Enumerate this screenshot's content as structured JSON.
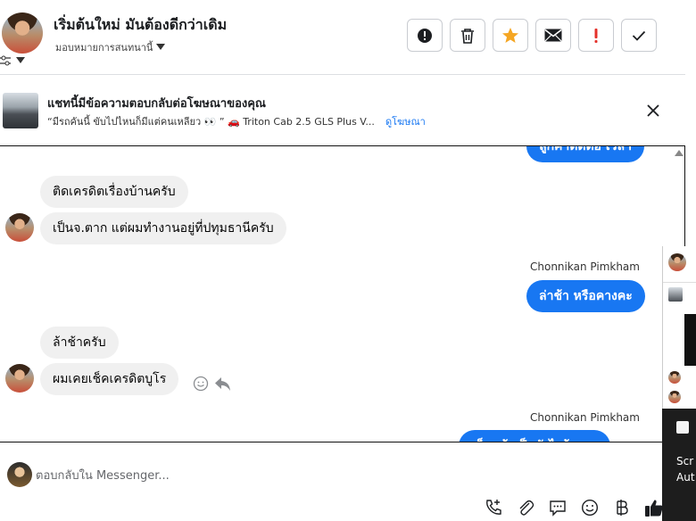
{
  "header": {
    "contact_name": "เริ่มต้นใหม่ มันต้องดีกว่าเดิม",
    "assign_label": "มอบหมายการสนทนานี้",
    "actions": [
      {
        "name": "report-button",
        "icon": "alert-circle-icon"
      },
      {
        "name": "delete-button",
        "icon": "trash-icon"
      },
      {
        "name": "star-button",
        "icon": "star-icon",
        "color": "#f5a623"
      },
      {
        "name": "mark-unread-button",
        "icon": "envelope-icon"
      },
      {
        "name": "follow-up-button",
        "icon": "exclamation-icon",
        "color": "#e4312b"
      },
      {
        "name": "done-button",
        "icon": "check-icon"
      }
    ]
  },
  "ad_bar": {
    "title": "แชทนี้มีข้อความตอบกลับต่อโฆษณาของคุณ",
    "quote": "“มีรถคันนี้ ขับไปไหนก็มีแต่คนเหลียว 👀 ” 🚗  Triton Cab 2.5 GLS Plus V...",
    "link": "ดูโฆษณา"
  },
  "messages": {
    "top_clipped": "ลูกค้าติดต่อ เวลา",
    "m1": "ติดเครดิตเรื่องบ้านครับ",
    "m2": "เป็นจ.ตาก แต่ผมทำงานอยู่ที่ปทุมธานีครับ",
    "sender1": "Chonnikan Pimkham",
    "m3": "ล่าช้า หรือคางคะ",
    "m4": "ล้าช้าครับ",
    "m5": "ผมเคยเช็คเครดิตบูโร",
    "sender2": "Chonnikan Pimkham",
    "m6_clipped": "เช็คแล้วเป็นยังไงบ้างคะ"
  },
  "composer": {
    "placeholder": "ตอบกลับใน Messenger..."
  },
  "side_window": {
    "line1": "Scr",
    "line2": "Aut"
  },
  "colors": {
    "accent": "#1877f2",
    "bubble_in": "#f0f0f0",
    "star": "#f5a623",
    "alert": "#e4312b"
  }
}
